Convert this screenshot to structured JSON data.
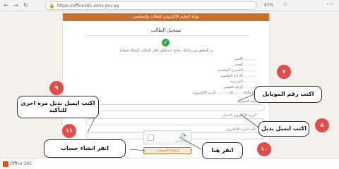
{
  "browser": {
    "back_icon": "back-arrow-icon",
    "forward_icon": "forward-arrow-icon",
    "reload_icon": "reload-icon",
    "url": "https://office365.emis.gov.eg",
    "zoom": "67%",
    "star_icon": "star-icon",
    "menu_icon": "menu-dots-icon"
  },
  "page": {
    "header_title": "بوابة التعليم الإلكتروني للطلاب والمعلمين",
    "register_title": "تسجيل الطالب",
    "success_message": "تم التحقق من بياناتك بنجاح. استكمل باقي البيانات لإنشاء حسابك",
    "info_lines": [
      "الاسم: ..........",
      "الصف: ..........",
      "المديرية التعليمية: ..........",
      "الإدارة التعليمية: ..........",
      "المدرسة: ..........",
      "الرقم القومي: ..........",
      "البريد الإلكتروني: ..........@..........edu.eg"
    ],
    "mobile_label": "رقم الموبايل",
    "alt_email_label": "البريد الإلكتروني البديل",
    "confirm_email_label": "تأكيد البريد الإلكتروني",
    "captcha_text": "reCAPTCHA",
    "create_button_label": "إنشاء الحساب"
  },
  "callouts": {
    "mobile": "اكتب رقم الموبايل",
    "alt_email": "اكتب ايميل بديل",
    "confirm_email": "اكتب ايميل بديل مرة اخرى للتأكيد",
    "click_here": "انقر هنا",
    "create_account": "انقر انشاء حساب"
  },
  "badges": {
    "mobile": "٧",
    "alt_email": "٨",
    "confirm_email": "٩",
    "click_here": "١٠",
    "create_account": "١١"
  },
  "taskbar": {
    "office_label": "Office 365"
  },
  "colors": {
    "accent": "#c8712e",
    "badge": "#e04e4a",
    "success": "#2eaa3e"
  }
}
